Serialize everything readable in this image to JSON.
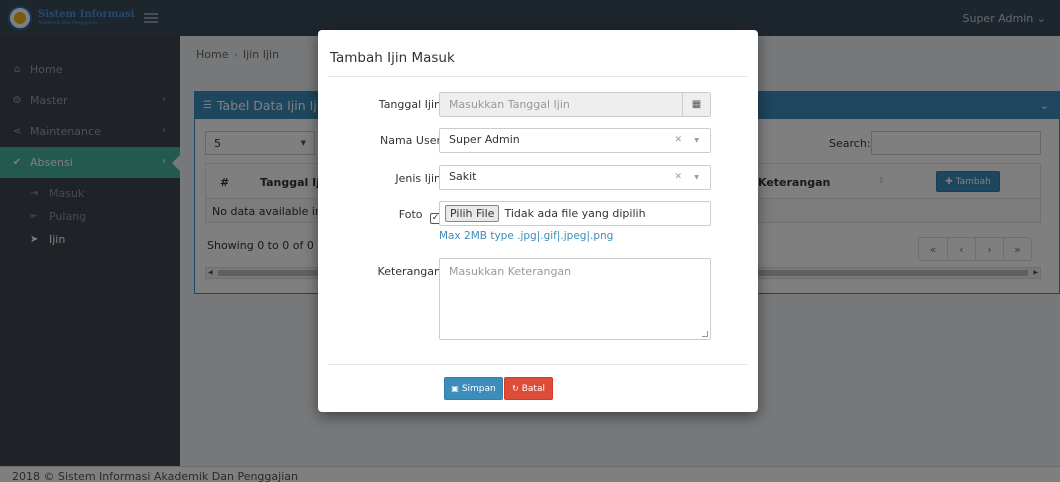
{
  "header": {
    "logo_title": "Sistem Informasi",
    "logo_subtitle": "Akademik Dan Penggajian",
    "user_menu": "Super Admin ⌄"
  },
  "sidebar": {
    "items": [
      {
        "label": "Home",
        "icon": "home-icon"
      },
      {
        "label": "Master",
        "icon": "cogs-icon"
      },
      {
        "label": "Maintenance",
        "icon": "share-icon"
      },
      {
        "label": "Absensi",
        "icon": "check-icon"
      }
    ],
    "sub_items": [
      {
        "label": "Masuk",
        "icon": "sign-in-icon"
      },
      {
        "label": "Pulang",
        "icon": "sign-out-icon"
      },
      {
        "label": "Ijin",
        "icon": "send-icon"
      }
    ],
    "colors": {
      "active": "#48b39e",
      "background": "#3e4650"
    }
  },
  "breadcrumb": {
    "home": "Home",
    "current": "Ijin Ijin"
  },
  "box": {
    "title": "Tabel Data Ijin Ijin",
    "length_value": "5",
    "search_label": "Search:",
    "columns": {
      "hash": "#",
      "tanggal": "Tanggal Ijin",
      "keterangan": "Keterangan"
    },
    "add_button": "Tambah",
    "empty_text": "No data available in table",
    "showing": "Showing 0 to 0 of 0 entries",
    "pager": [
      "«",
      "‹",
      "›",
      "»"
    ],
    "accent": "#3c8dbc"
  },
  "footer": {
    "text": "2018 © Sistem Informasi Akademik Dan Penggajian"
  },
  "modal": {
    "title": "Tambah Ijin Masuk",
    "tanggal_label": "Tanggal Ijin",
    "tanggal_placeholder": "Masukkan Tanggal Ijin",
    "user_label": "Nama User",
    "user_value": "Super Admin",
    "jenis_label": "Jenis Ijin",
    "jenis_value": "Sakit",
    "foto_label": "Foto",
    "foto_checked": true,
    "file_button": "Pilih File",
    "file_status": "Tidak ada file yang dipilih",
    "file_hint": "Max 2MB type .jpg|.gif|.jpeg|.png",
    "ket_label": "Keterangan",
    "ket_placeholder": "Masukkan Keterangan",
    "save_label": "Simpan",
    "cancel_label": "Batal",
    "save_color": "#3c8dbc",
    "cancel_color": "#dd4b39"
  }
}
